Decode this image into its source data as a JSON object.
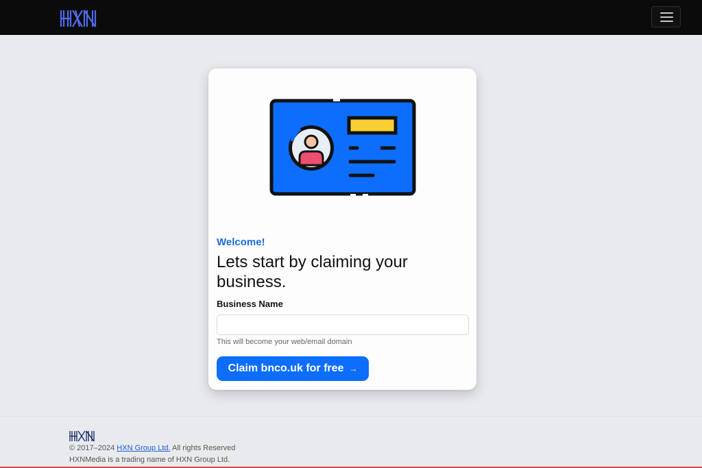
{
  "brand": {
    "logo_text": "HXN",
    "logo_color": "#4f6bf0",
    "footer_logo_color": "#1a2a6b"
  },
  "nav": {
    "menu_icon": "hamburger-menu-icon"
  },
  "card": {
    "illustration_icon": "id-card-icon",
    "eyebrow": "Welcome!",
    "headline": "Lets start by claiming your business.",
    "field_label": "Business Name",
    "field_value": "",
    "field_help": "This will become your web/email domain",
    "button_label": "Claim bnco.uk for free",
    "button_icon": "arrow-right-icon",
    "accent_color": "#0d6efd"
  },
  "footer": {
    "copyright_prefix": "© 2017–2024",
    "company_link": "HXN Group Ltd.",
    "rights": "All rights Reserved",
    "trading_name": "HXNMedia is a trading name of HXN Group Ltd."
  }
}
